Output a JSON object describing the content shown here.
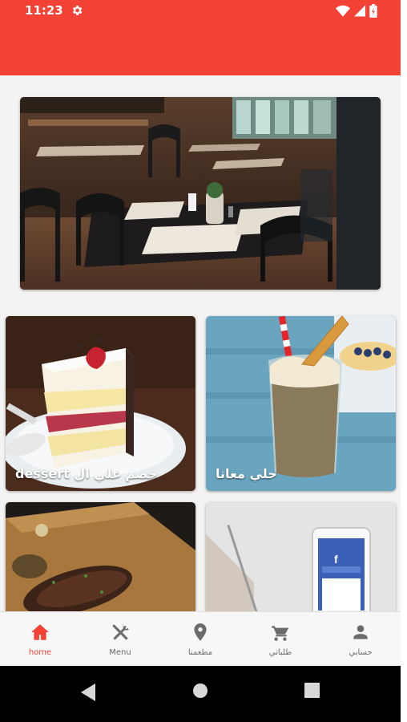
{
  "status_bar": {
    "time": "11:23"
  },
  "hero": {
    "image": "restaurant-interior"
  },
  "cards": [
    {
      "label": "خصم علي ال dessert",
      "image": "cake-slice"
    },
    {
      "label": "حلي معانا",
      "image": "milkshake"
    },
    {
      "label": "",
      "image": "steak"
    },
    {
      "label": "",
      "image": "facebook-phone"
    }
  ],
  "bottom_nav": {
    "items": [
      {
        "label": "home",
        "icon": "home-icon",
        "active": true
      },
      {
        "label": "Menu",
        "icon": "cutlery-icon",
        "active": false
      },
      {
        "label": "مطعمنا",
        "icon": "location-pin-icon",
        "active": false
      },
      {
        "label": "طلباتي",
        "icon": "cart-icon",
        "active": false
      },
      {
        "label": "حسابي",
        "icon": "person-icon",
        "active": false
      }
    ]
  },
  "theme": {
    "accent": "#f44336",
    "inactive": "#6b6b6b",
    "background": "#f3f3f3"
  }
}
